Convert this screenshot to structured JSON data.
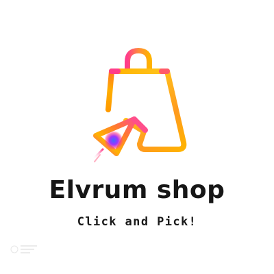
{
  "brand": {
    "name": "Elvrum shop",
    "tagline": "Click and Pick!"
  },
  "logo": {
    "icons": [
      "shopping-bag-icon",
      "cursor-arrow-icon"
    ],
    "colors": {
      "orange": "#ffb300",
      "deep_orange": "#ff6a2b",
      "pink": "#ff3d8a",
      "magenta": "#d026e0",
      "blue": "#3d6bff"
    }
  },
  "colors": {
    "background": "#ffffff",
    "text": "#161616"
  }
}
